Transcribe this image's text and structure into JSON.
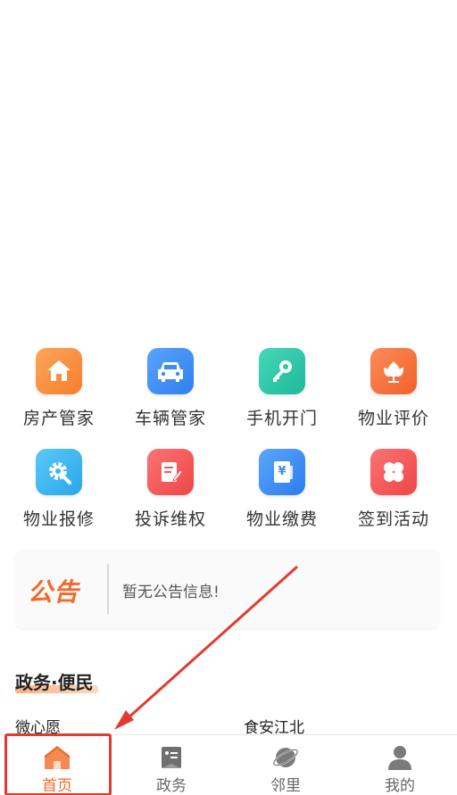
{
  "services": [
    {
      "label": "房产管家",
      "icon": "house-icon",
      "color": "#f8913d"
    },
    {
      "label": "车辆管家",
      "icon": "car-icon",
      "color": "#3a8bf3"
    },
    {
      "label": "手机开门",
      "icon": "key-icon",
      "color": "#2bc8a8"
    },
    {
      "label": "物业评价",
      "icon": "flower-icon",
      "color": "#f7703f"
    },
    {
      "label": "物业报修",
      "icon": "gear-icon",
      "color": "#3bb6f2"
    },
    {
      "label": "投诉维权",
      "icon": "complaint-icon",
      "color": "#f35a5a"
    },
    {
      "label": "物业缴费",
      "icon": "payment-icon",
      "color": "#3a8bf3"
    },
    {
      "label": "签到活动",
      "icon": "clover-icon",
      "color": "#f45858"
    }
  ],
  "notice": {
    "tag": "公告",
    "message": "暂无公告信息!"
  },
  "section": {
    "title": "政务·便民",
    "items": [
      "微心愿",
      "食安江北"
    ]
  },
  "tabbar": {
    "tabs": [
      {
        "label": "首页",
        "icon": "home-icon",
        "active": true
      },
      {
        "label": "政务",
        "icon": "government-icon",
        "active": false
      },
      {
        "label": "邻里",
        "icon": "planet-icon",
        "active": false
      },
      {
        "label": "我的",
        "icon": "user-icon",
        "active": false
      }
    ]
  },
  "colors": {
    "accent": "#f26a2b",
    "annotation": "#e23b2e"
  }
}
